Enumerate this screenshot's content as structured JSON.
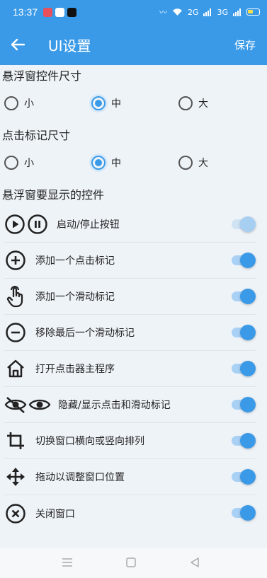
{
  "status_bar": {
    "time": "13:37",
    "network_labels": [
      "2G",
      "3G"
    ]
  },
  "app_bar": {
    "title": "UI设置",
    "save_label": "保存",
    "back_icon": "arrow-left-icon"
  },
  "sections": {
    "float_size": {
      "title": "悬浮窗控件尺寸",
      "options": [
        "小",
        "中",
        "大"
      ],
      "selected": "中"
    },
    "mark_size": {
      "title": "点击标记尺寸",
      "options": [
        "小",
        "中",
        "大"
      ],
      "selected": "中"
    },
    "controls": {
      "title": "悬浮窗要显示的控件",
      "items": [
        {
          "label": "启动/停止按钮",
          "icon": "play-pause-icon",
          "enabled": true,
          "dimmed": true
        },
        {
          "label": "添加一个点击标记",
          "icon": "plus-circle-icon",
          "enabled": true,
          "dimmed": false
        },
        {
          "label": "添加一个滑动标记",
          "icon": "swipe-hand-icon",
          "enabled": true,
          "dimmed": false
        },
        {
          "label": "移除最后一个滑动标记",
          "icon": "minus-circle-icon",
          "enabled": true,
          "dimmed": false
        },
        {
          "label": "打开点击器主程序",
          "icon": "home-icon",
          "enabled": true,
          "dimmed": false
        },
        {
          "label": "隐藏/显示点击和滑动标记",
          "icon": "eye-toggle-icon",
          "enabled": true,
          "dimmed": false
        },
        {
          "label": "切换窗口横向或竖向排列",
          "icon": "crop-rotate-icon",
          "enabled": true,
          "dimmed": false
        },
        {
          "label": "拖动以调整窗口位置",
          "icon": "move-arrows-icon",
          "enabled": true,
          "dimmed": false
        },
        {
          "label": "关闭窗口",
          "icon": "close-circle-icon",
          "enabled": true,
          "dimmed": false
        }
      ]
    }
  },
  "colors": {
    "primary": "#3a9ae8",
    "background": "#eef3f8"
  }
}
